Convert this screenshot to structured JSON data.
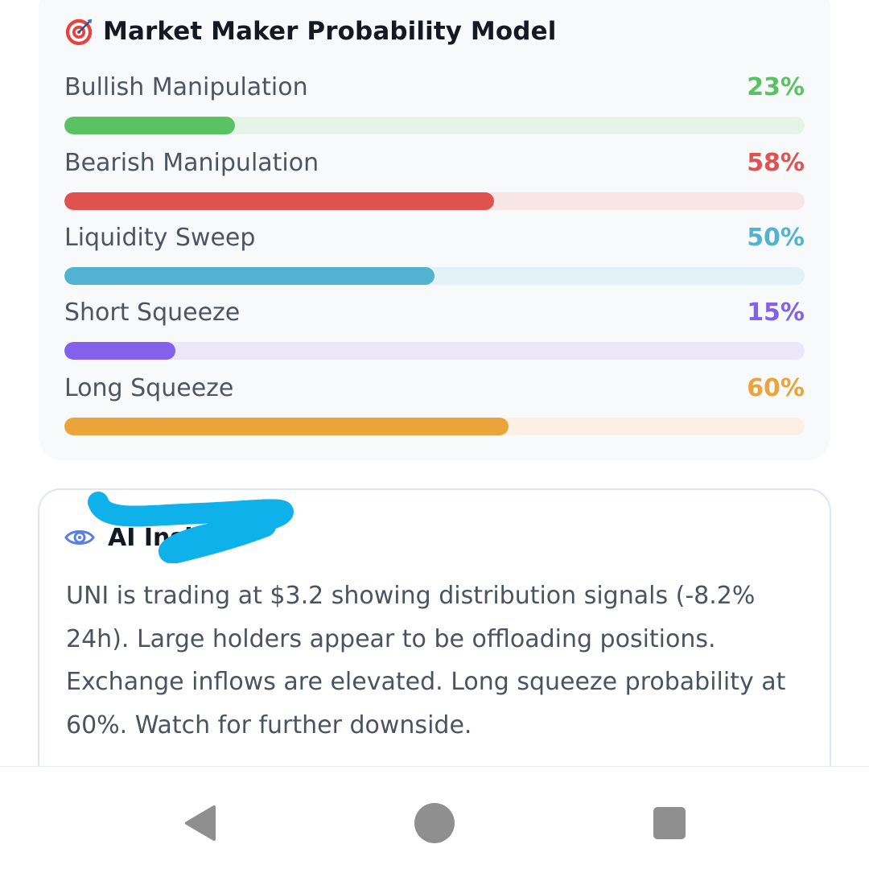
{
  "card": {
    "title": "Market Maker Probability Model",
    "icon": "target-icon",
    "metrics": [
      {
        "label": "Bullish Manipulation",
        "value": "23%",
        "percent": 23,
        "color": "#5ac262",
        "track": "#e5f3e8"
      },
      {
        "label": "Bearish Manipulation",
        "value": "58%",
        "percent": 58,
        "color": "#e0524f",
        "track": "#f8e5e6"
      },
      {
        "label": "Liquidity Sweep",
        "value": "50%",
        "percent": 50,
        "color": "#52b3d1",
        "track": "#e1f1f5"
      },
      {
        "label": "Short Squeeze",
        "value": "15%",
        "percent": 15,
        "color": "#8361ea",
        "track": "#ebe7f9"
      },
      {
        "label": "Long Squeeze",
        "value": "60%",
        "percent": 60,
        "color": "#eaa43a",
        "track": "#fbf0e3"
      }
    ]
  },
  "analysis": {
    "icon": "eye-icon",
    "title": "AI Insight",
    "text": "UNI is trading at $3.2 showing distribution signals (-8.2% 24h). Large holders appear to be offloading positions. Exchange inflows are elevated. Long squeeze probability at 60%. Watch for further downside."
  },
  "colors": {
    "accent_eye": "#5b7fe0",
    "redaction_scribble": "#0fb1ea"
  },
  "navbar": {
    "back_icon": "back-triangle-icon",
    "home_icon": "home-circle-icon",
    "recents_icon": "recents-square-icon"
  }
}
